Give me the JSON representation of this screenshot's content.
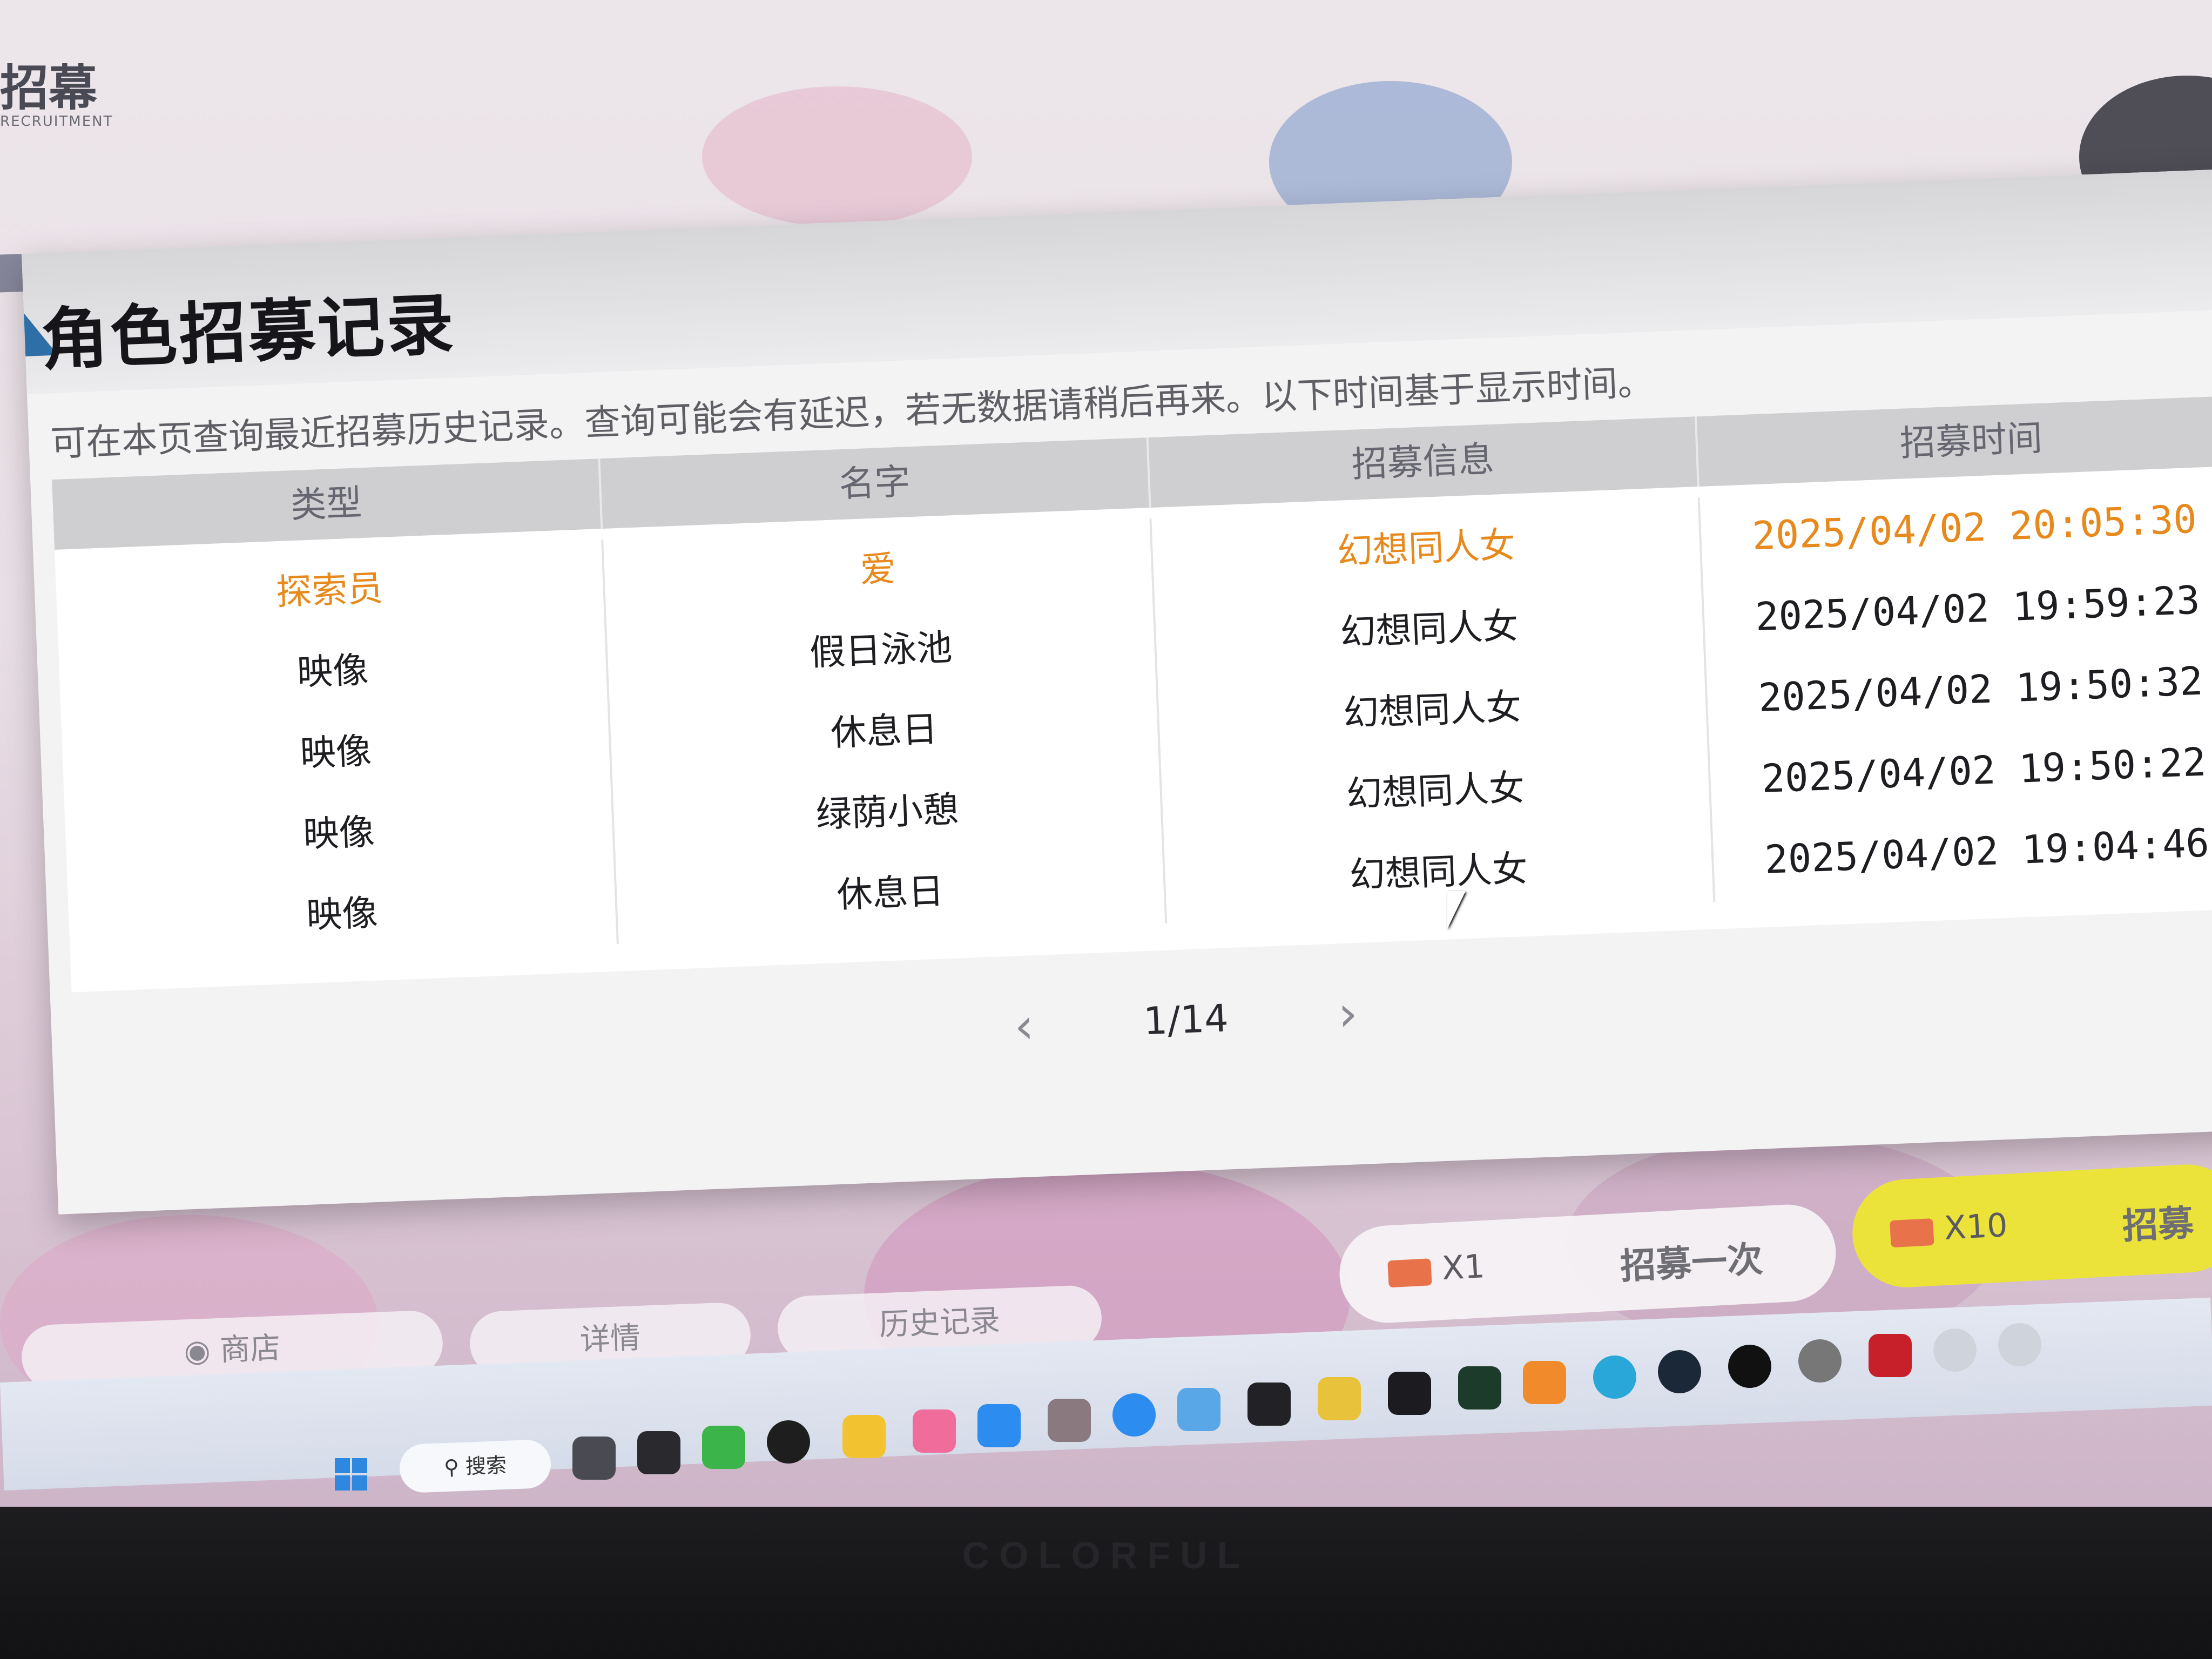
{
  "dialog": {
    "title": "角色招募记录",
    "description": "可在本页查询最近招募历史记录。查询可能会有延迟，若无数据请稍后再来。以下时间基于显示时间。",
    "columns": [
      "类型",
      "名字",
      "招募信息",
      "招募时间"
    ],
    "rows": [
      {
        "type": "探索员",
        "name": "爱",
        "info": "幻想同人女",
        "time": "2025/04/02 20:05:30",
        "highlight": true
      },
      {
        "type": "映像",
        "name": "假日泳池",
        "info": "幻想同人女",
        "time": "2025/04/02 19:59:23",
        "highlight": false
      },
      {
        "type": "映像",
        "name": "休息日",
        "info": "幻想同人女",
        "time": "2025/04/02 19:50:32",
        "highlight": false
      },
      {
        "type": "映像",
        "name": "绿荫小憩",
        "info": "幻想同人女",
        "time": "2025/04/02 19:50:22",
        "highlight": false
      },
      {
        "type": "映像",
        "name": "休息日",
        "info": "幻想同人女",
        "time": "2025/04/02 19:04:46",
        "highlight": false
      }
    ],
    "pagination": {
      "text": "1/14",
      "prev_icon": "chevron-left-icon",
      "next_icon": "chevron-right-icon"
    }
  },
  "game_bar": {
    "shop_label": "商店",
    "details_label": "详情",
    "history_label": "历史记录",
    "once_count": "X1",
    "once_label": "招募一次",
    "ten_count": "X10",
    "ten_label": "招募"
  },
  "taskbar": {
    "search_label": "搜索"
  },
  "brand": "COLORFUL",
  "colors": {
    "highlight": "#e7891c",
    "dialog_bg": "#f3f3f4",
    "header_bg": "#cfcfd1",
    "accent": "#2f6fa8",
    "ten_button": "#ece33a"
  }
}
